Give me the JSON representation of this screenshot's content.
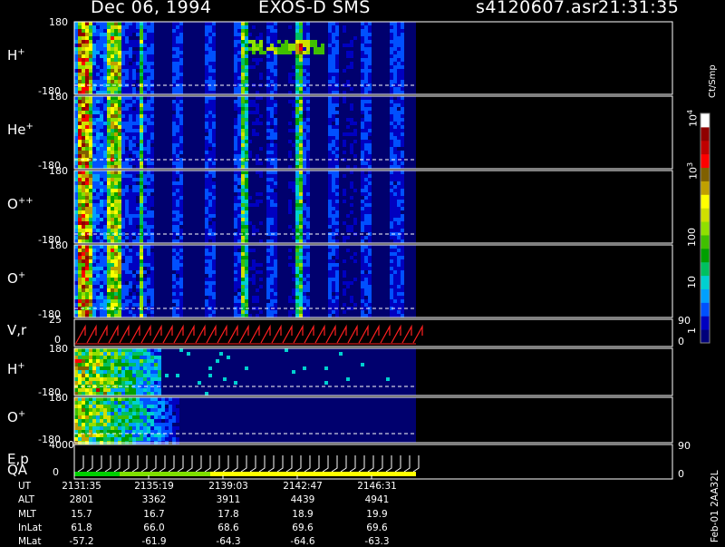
{
  "header": {
    "date": "Dec 06, 1994",
    "instrument": "EXOS-D SMS",
    "filename": "s4120607.asr",
    "time": "21:31:35"
  },
  "panels": [
    {
      "id": "hplus",
      "species": "H",
      "charge": "+",
      "ytop": "180",
      "ybot": "-180"
    },
    {
      "id": "heplus",
      "species": "He",
      "charge": "+",
      "ytop": "180",
      "ybot": "-180"
    },
    {
      "id": "oplusplus",
      "species": "O",
      "charge": "++",
      "ytop": "180",
      "ybot": "-180"
    },
    {
      "id": "oplus",
      "species": "O",
      "charge": "+",
      "ytop": "180",
      "ybot": "-180"
    },
    {
      "id": "vr",
      "species": "V,r",
      "charge": "",
      "ytop": "25",
      "ybot": "0",
      "right_top": "90",
      "right_bot": "0"
    },
    {
      "id": "hplus2",
      "species": "H",
      "charge": "+",
      "ytop": "180",
      "ybot": "-180"
    },
    {
      "id": "oplus2",
      "species": "O",
      "charge": "+",
      "ytop": "180",
      "ybot": "-180"
    },
    {
      "id": "ep",
      "species": "E,p",
      "charge": "",
      "ytop": "4000",
      "ybot": "0",
      "right_top": "90",
      "right_bot": "0"
    }
  ],
  "qa_label": "QA",
  "colorbar": {
    "unit": "Ct/Smp",
    "ticks": [
      {
        "label": "1",
        "exp": ""
      },
      {
        "label": "10",
        "exp": ""
      },
      {
        "label": "100",
        "exp": ""
      },
      {
        "label": "10",
        "exp": "3"
      },
      {
        "label": "10",
        "exp": "4"
      }
    ],
    "colors": [
      "#00007a",
      "#0000c0",
      "#0050ff",
      "#00a0ff",
      "#00d0d0",
      "#00c060",
      "#00a000",
      "#40c000",
      "#90e000",
      "#d0e000",
      "#ffff00",
      "#c0a000",
      "#806000",
      "#ff0000",
      "#c00000",
      "#900000",
      "#ffffff"
    ]
  },
  "ephemeris": {
    "labels": [
      "UT",
      "ALT",
      "MLT",
      "InLat",
      "MLat"
    ],
    "columns": [
      [
        "2131:35",
        "2801",
        "15.7",
        "61.8",
        "-57.2"
      ],
      [
        "2135:19",
        "3362",
        "16.7",
        "66.0",
        "-61.9"
      ],
      [
        "2139:03",
        "3911",
        "17.8",
        "68.6",
        "-64.3"
      ],
      [
        "2142:47",
        "4439",
        "18.9",
        "69.6",
        "-64.6"
      ],
      [
        "2146:31",
        "4941",
        "19.9",
        "69.6",
        "-63.3"
      ]
    ]
  },
  "footer_id": "Feb-01 2AA32L",
  "chart_data": {
    "type": "heatmap",
    "title": "Dec 06, 1994   EXOS-D SMS",
    "x_ticks": [
      "2131:35",
      "2135:19",
      "2139:03",
      "2142:47",
      "2146:31"
    ],
    "ion_panels": [
      "H+",
      "He+",
      "O++",
      "O+",
      "H+",
      "O+"
    ],
    "y_range_deg": [
      -180,
      180
    ],
    "vr_range": [
      0,
      25
    ],
    "ep_range": [
      0,
      4000
    ],
    "colorbar_range_counts": [
      1,
      10000
    ],
    "colorbar_scale": "log",
    "data_extent_fraction": 0.51
  }
}
